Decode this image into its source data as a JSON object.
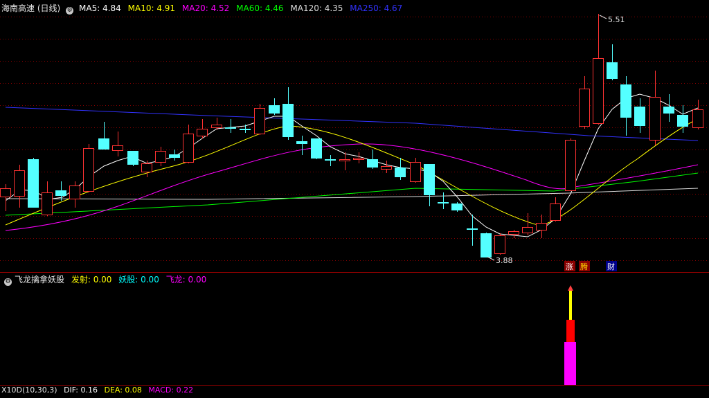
{
  "main_panel": {
    "stock_title": "海南高速 (日线)",
    "ma_labels": [
      {
        "text": "MA5: 4.84",
        "color": "#ffffff"
      },
      {
        "text": "MA10: 4.91",
        "color": "#ffff00"
      },
      {
        "text": "MA20: 4.52",
        "color": "#ff00ff"
      },
      {
        "text": "MA60: 4.46",
        "color": "#00ff00"
      },
      {
        "text": "MA120: 4.35",
        "color": "#dcdcdc"
      },
      {
        "text": "MA250: 4.67",
        "color": "#3232ff"
      }
    ],
    "high_marker": "5.51",
    "low_marker": "3.88",
    "badges": [
      {
        "text": "涨",
        "bg": "#8b0000"
      },
      {
        "text": "腾",
        "bg": "#8b0000"
      },
      {
        "text": "财",
        "bg": "#00008b"
      }
    ]
  },
  "indicator_panel": {
    "title": "飞龙擒拿妖股",
    "values": [
      {
        "text": "发射: 0.00",
        "color": "#ffff00"
      },
      {
        "text": "妖股: 0.00",
        "color": "#00ffff"
      },
      {
        "text": "飞龙: 0.00",
        "color": "#ff00ff"
      }
    ]
  },
  "bottom_panel": {
    "title": "X10D(10,30,3)",
    "values": [
      {
        "text": "DIF: 0.16",
        "color": "#ffffff"
      },
      {
        "text": "DEA: 0.08",
        "color": "#ffff00"
      },
      {
        "text": "MACD: 0.22",
        "color": "#ff00ff"
      }
    ]
  },
  "colors": {
    "up": "#ff3232",
    "down": "#54ffff",
    "grid": "#8b0000",
    "separator": "#a00000"
  }
}
